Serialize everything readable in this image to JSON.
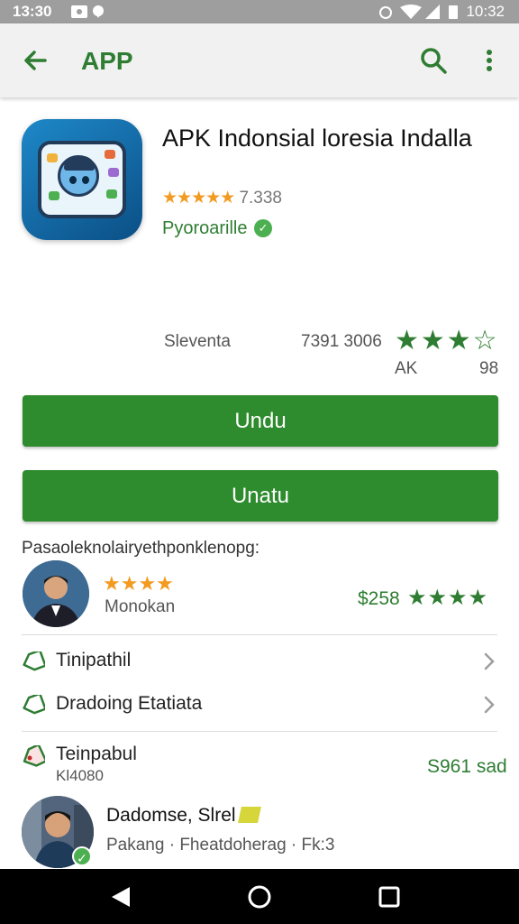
{
  "status_bar": {
    "time": "13:30",
    "right_time": "10:32"
  },
  "app_bar": {
    "title": "APP"
  },
  "app": {
    "name": "APK Indonsial loresia Indalla",
    "stars": "★★★★★",
    "rating": "7.338",
    "developer": "Pyoroarille"
  },
  "stats": {
    "label": "Sleventa",
    "value": "7391 3006",
    "stars": "★★★☆",
    "sub_left": "AK",
    "sub_right": "98"
  },
  "buttons": {
    "primary": "Undu",
    "secondary": "Unatu"
  },
  "section": {
    "label": "Pasaoleknolairyethponklenopg:"
  },
  "review": {
    "stars": "★★★★",
    "name": "Monokan",
    "price": "$258",
    "price_stars": "★★★★"
  },
  "list": [
    {
      "label": "Tinipathil"
    },
    {
      "label": "Dradoing Etatiata"
    }
  ],
  "promo": {
    "title": "Teinpabul",
    "sub": "Kl4080",
    "price": "S961 sad"
  },
  "user": {
    "name": "Dadomse, Slrel",
    "meta": "Pakang · Fheatdoherag · Fk:3"
  },
  "colors": {
    "accent": "#2e7d32",
    "button": "#2e8b2e",
    "star": "#f29b20"
  },
  "icons": [
    "back-arrow-icon",
    "search-icon",
    "more-vert-icon",
    "tag-icon",
    "chevron-right-icon",
    "verified-icon",
    "nav-back-icon",
    "nav-home-icon",
    "nav-recents-icon"
  ]
}
